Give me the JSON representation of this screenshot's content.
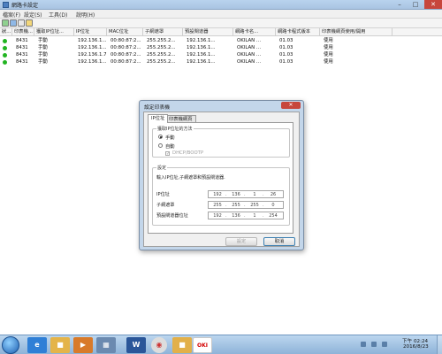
{
  "window": {
    "title": "網路卡設定",
    "menu": [
      "檔案(F)",
      "設定(S)",
      "工具(D)",
      "說明(H)"
    ]
  },
  "toolbar": {
    "icons": [
      "refresh-icon",
      "search-icon",
      "printer-icon",
      "info-icon"
    ]
  },
  "table": {
    "columns": [
      "狀...",
      "印表機...",
      "獲取IP位址...",
      "IP位址",
      "MAC位址",
      "子網遮罩",
      "預設閘道器",
      "網路卡名...",
      "網路卡程式版本",
      "印表機網頁使用/開用"
    ],
    "rows": [
      [
        "",
        "8431",
        "手動",
        "192.136.1...",
        "00:80:87:2...",
        "255.255.2...",
        "192.136.1...",
        "OKILAN ...",
        "01.03",
        "使用"
      ],
      [
        "",
        "8431",
        "手動",
        "192.136.1...",
        "00:80:87:2...",
        "255.255.2...",
        "192.136.1...",
        "OKILAN ...",
        "01.03",
        "使用"
      ],
      [
        "",
        "8431",
        "手動",
        "192.136.1.7",
        "00:80:87:2...",
        "255.255.2...",
        "192.136.1...",
        "OKILAN ...",
        "01.03",
        "使用"
      ],
      [
        "",
        "8431",
        "手動",
        "192.136.1...",
        "00:80:87:2...",
        "255.255.2...",
        "192.136.1...",
        "OKILAN ...",
        "01.03",
        "使用"
      ]
    ],
    "status_color": "#22b422"
  },
  "dialog": {
    "title": "設定印表機",
    "close_label": "✕",
    "tabs": [
      "IP位址",
      "印表機網頁"
    ],
    "method_group_label": "獲取IP位址的方法",
    "manual_label": "手動",
    "auto_label": "自動",
    "dhcp_label": "DHCP/BOOTP",
    "settings_group_label": "設定",
    "instruction": "輸入IP位址,子網遮罩和預設閘道器.",
    "ip_label": "IP位址",
    "ip_value": [
      "192",
      "136",
      "1",
      "26"
    ],
    "subnet_label": "子網遮罩",
    "subnet_value": [
      "255",
      "255",
      "255",
      "0"
    ],
    "gateway_label": "預設閘道器位址",
    "gateway_value": [
      "192",
      "136",
      "1",
      "254"
    ],
    "ok_label": "設定",
    "cancel_label": "取消"
  },
  "taskbar": {
    "clock_time": "下午 02:24",
    "clock_date": "2016/8/23",
    "word_label": "W",
    "oki_label": "OKI"
  }
}
